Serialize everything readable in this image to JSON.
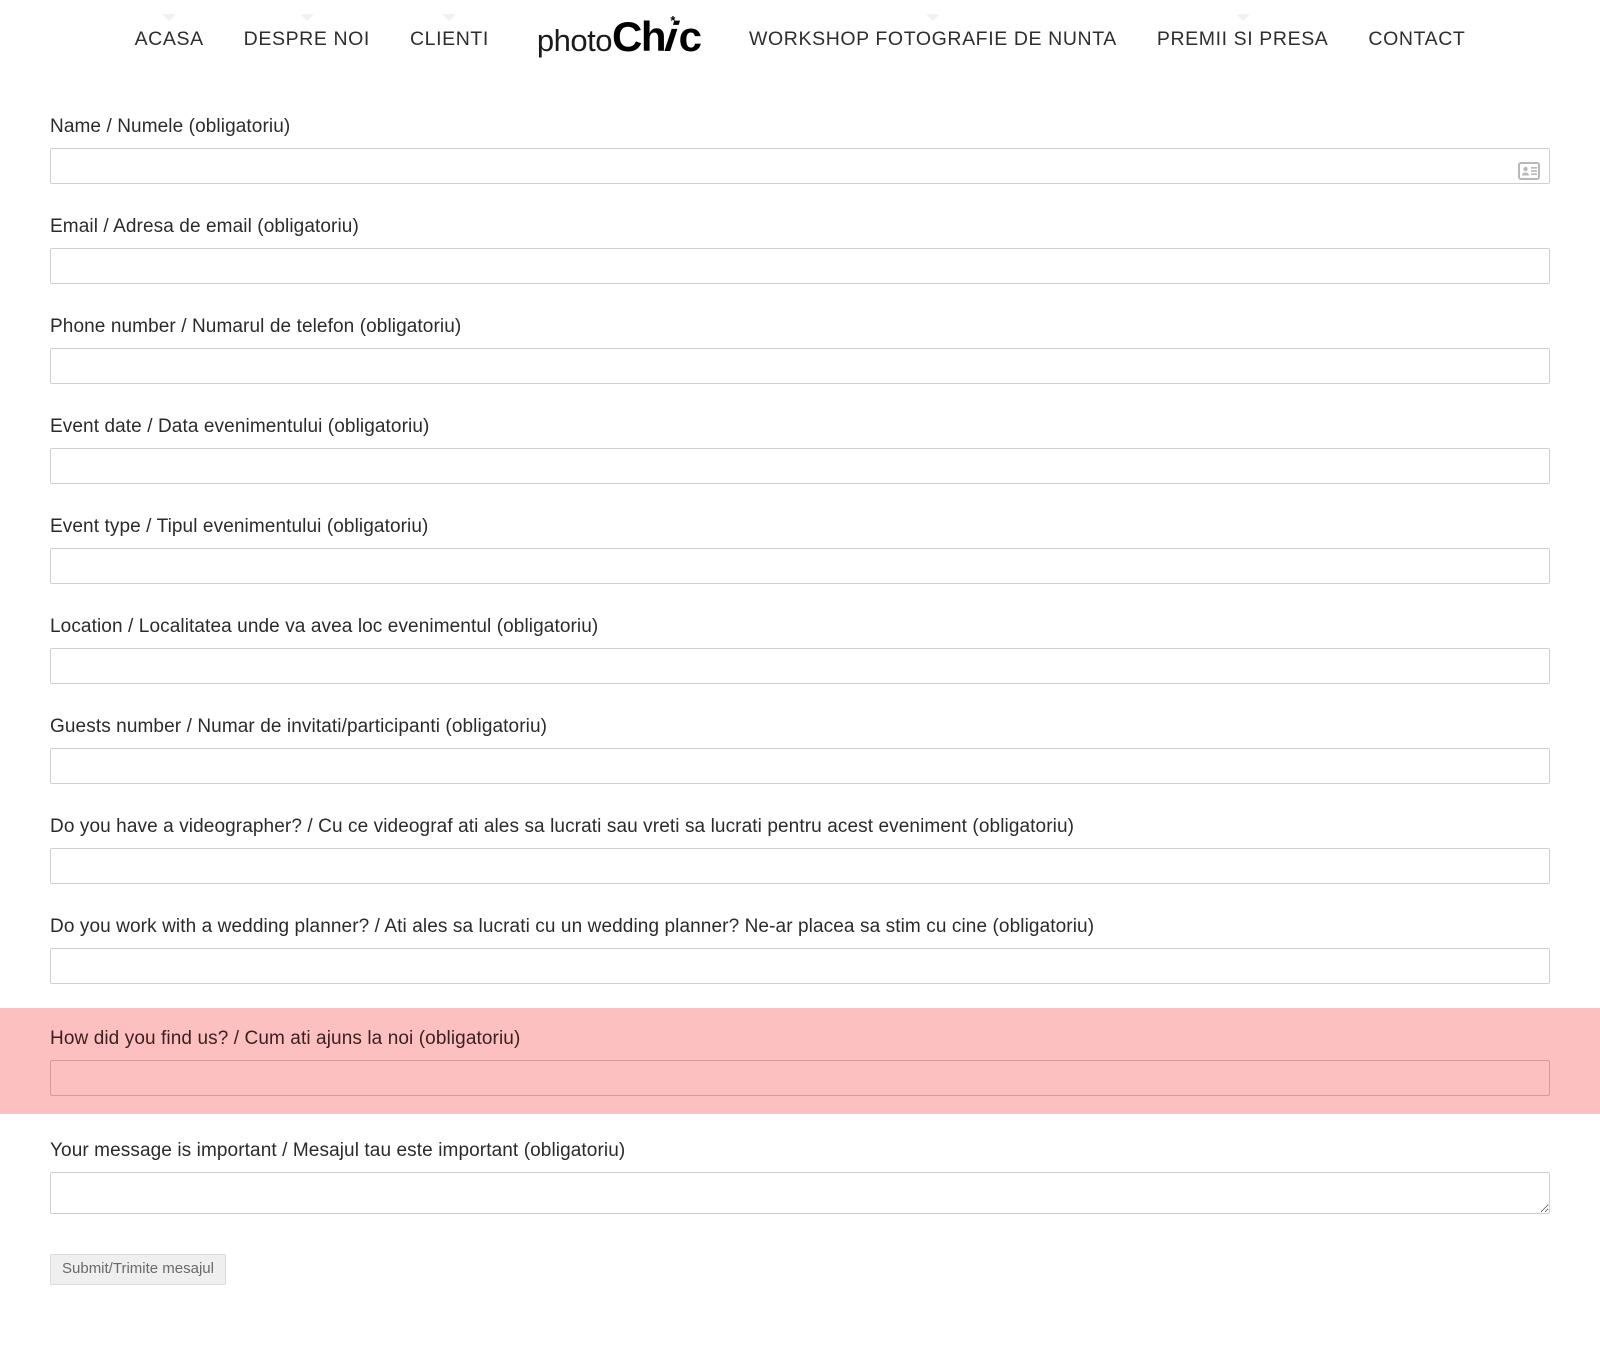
{
  "header": {
    "nav_left": [
      {
        "label": "ACASA",
        "has_dropdown": true
      },
      {
        "label": "DESPRE NOI",
        "has_dropdown": true
      },
      {
        "label": "CLIENTI",
        "has_dropdown": true
      }
    ],
    "logo": {
      "part_light": "photo",
      "part_bold_1": "Ch",
      "part_italic": "i",
      "part_bold_2": "c",
      "star": "*",
      "full_text": "photoChic"
    },
    "nav_right": [
      {
        "label": "WORKSHOP FOTOGRAFIE DE NUNTA",
        "has_dropdown": true
      },
      {
        "label": "PREMII SI PRESA",
        "has_dropdown": true
      },
      {
        "label": "CONTACT",
        "has_dropdown": false
      }
    ]
  },
  "form": {
    "fields": [
      {
        "name": "name",
        "label": "Name / Numele (obligatoriu)",
        "value": "",
        "placeholder": "",
        "type": "text",
        "icon": "contact-card-icon",
        "highlighted": false
      },
      {
        "name": "email",
        "label": "Email / Adresa de email (obligatoriu)",
        "value": "",
        "placeholder": "",
        "type": "email",
        "highlighted": false
      },
      {
        "name": "phone",
        "label": "Phone number / Numarul de telefon (obligatoriu)",
        "value": "",
        "placeholder": "",
        "type": "text",
        "highlighted": false
      },
      {
        "name": "event-date",
        "label": "Event date / Data evenimentului (obligatoriu)",
        "value": "",
        "placeholder": "",
        "type": "text",
        "highlighted": false
      },
      {
        "name": "event-type",
        "label": "Event type / Tipul evenimentului (obligatoriu)",
        "value": "",
        "placeholder": "",
        "type": "text",
        "highlighted": false
      },
      {
        "name": "location",
        "label": "Location / Localitatea unde va avea loc evenimentul (obligatoriu)",
        "value": "",
        "placeholder": "",
        "type": "text",
        "highlighted": false
      },
      {
        "name": "guests-number",
        "label": "Guests number / Numar de invitati/participanti (obligatoriu)",
        "value": "",
        "placeholder": "",
        "type": "text",
        "highlighted": false
      },
      {
        "name": "videographer",
        "label": "Do you have a videographer? / Cu ce videograf ati ales sa lucrati sau vreti sa lucrati pentru acest eveniment (obligatoriu)",
        "value": "",
        "placeholder": "",
        "type": "text",
        "highlighted": false
      },
      {
        "name": "wedding-planner",
        "label": "Do you work with a wedding planner? / Ati ales sa lucrati cu un wedding planner? Ne-ar placea sa stim cu cine (obligatoriu)",
        "value": "",
        "placeholder": "",
        "type": "text",
        "highlighted": false
      },
      {
        "name": "how-did-you-find-us",
        "label": "How did you find us? / Cum ati ajuns la noi (obligatoriu)",
        "value": "",
        "placeholder": "",
        "type": "text",
        "highlighted": true
      }
    ],
    "message": {
      "name": "message",
      "label": "Your message is important / Mesajul tau este important (obligatoriu)",
      "value": "",
      "placeholder": ""
    },
    "submit_label": "Submit/Trimite mesajul"
  },
  "colors": {
    "page_background": "#ffffff",
    "text": "#2b2b2b",
    "input_border": "#cfcfcf",
    "highlight_background": "#fcc0c0",
    "highlight_border": "#d79a9a",
    "highlight_text": "#3b1f1f",
    "submit_background": "#efefef",
    "submit_text": "#6a6a6a",
    "nav_caret": "#f1f1f1"
  }
}
